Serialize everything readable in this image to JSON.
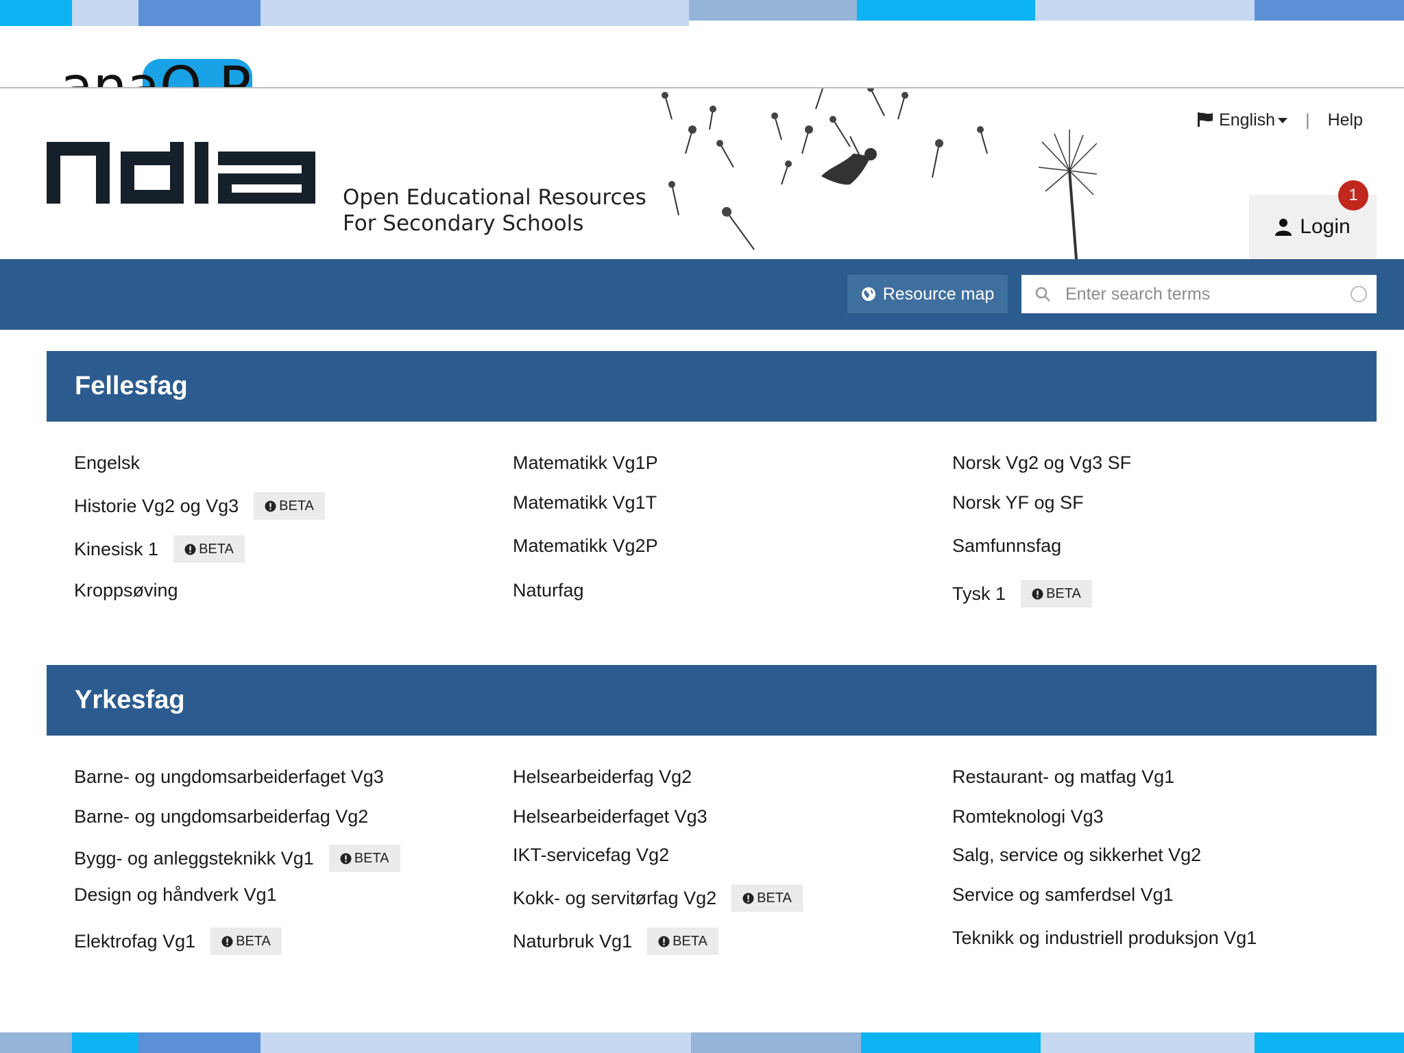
{
  "header": {
    "sliver_text": "anaO P",
    "logo": "ndla",
    "tagline_line1": "Open Educational Resources",
    "tagline_line2": "For Secondary Schools",
    "language": "English",
    "help": "Help",
    "login": "Login",
    "notification_count": "1"
  },
  "nav": {
    "resource_map": "Resource map",
    "search_placeholder": "Enter search terms"
  },
  "beta_label": "BETA",
  "sections": [
    {
      "title": "Fellesfag",
      "columns": [
        [
          {
            "label": "Engelsk",
            "beta": false
          },
          {
            "label": "Historie Vg2 og Vg3",
            "beta": true
          },
          {
            "label": "Kinesisk 1",
            "beta": true
          },
          {
            "label": "Kroppsøving",
            "beta": false
          }
        ],
        [
          {
            "label": "Matematikk Vg1P",
            "beta": false
          },
          {
            "label": "Matematikk Vg1T",
            "beta": false
          },
          {
            "label": "Matematikk Vg2P",
            "beta": false
          },
          {
            "label": "Naturfag",
            "beta": false
          }
        ],
        [
          {
            "label": "Norsk Vg2 og Vg3 SF",
            "beta": false
          },
          {
            "label": "Norsk YF og SF",
            "beta": false
          },
          {
            "label": "Samfunnsfag",
            "beta": false
          },
          {
            "label": "Tysk 1",
            "beta": true
          }
        ]
      ]
    },
    {
      "title": "Yrkesfag",
      "columns": [
        [
          {
            "label": "Barne- og ungdomsarbeiderfaget Vg3",
            "beta": false
          },
          {
            "label": "Barne- og ungdomsarbeiderfag Vg2",
            "beta": false
          },
          {
            "label": "Bygg- og anleggsteknikk Vg1",
            "beta": true
          },
          {
            "label": "Design og håndverk Vg1",
            "beta": false
          },
          {
            "label": "Elektrofag Vg1",
            "beta": true
          }
        ],
        [
          {
            "label": "Helsearbeiderfag Vg2",
            "beta": false
          },
          {
            "label": "Helsearbeiderfaget Vg3",
            "beta": false
          },
          {
            "label": "IKT-servicefag Vg2",
            "beta": false
          },
          {
            "label": "Kokk- og servitørfag Vg2",
            "beta": true
          },
          {
            "label": "Naturbruk Vg1",
            "beta": true
          }
        ],
        [
          {
            "label": "Restaurant- og matfag Vg1",
            "beta": false
          },
          {
            "label": "Romteknologi Vg3",
            "beta": false
          },
          {
            "label": "Salg, service og sikkerhet Vg2",
            "beta": false
          },
          {
            "label": "Service og samferdsel Vg1",
            "beta": false
          },
          {
            "label": "Teknikk og industriell produksjon Vg1",
            "beta": false
          }
        ]
      ]
    }
  ],
  "colors": {
    "brand_blue": "#2c5c8f",
    "stripe_light": "#c6d9f0",
    "stripe_mid": "#5b8fd6",
    "stripe_cyan": "#0db3f3",
    "badge_red": "#c0281c"
  }
}
